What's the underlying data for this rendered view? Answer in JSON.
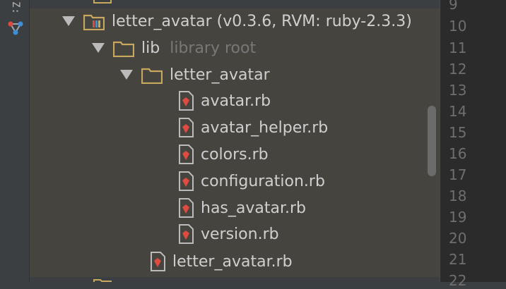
{
  "sidebar": {
    "tool_label": "Z:"
  },
  "project": {
    "root": {
      "name": "letter_avatar (v0.3.6, RVM: ruby-2.3.3)"
    },
    "lib": {
      "name": "lib",
      "hint": "library root"
    },
    "subfolder": {
      "name": "letter_avatar"
    },
    "files": [
      "avatar.rb",
      "avatar_helper.rb",
      "colors.rb",
      "configuration.rb",
      "has_avatar.rb",
      "version.rb"
    ],
    "lib_file": "letter_avatar.rb"
  },
  "gutter": {
    "lines": [
      "9",
      "10",
      "11",
      "12",
      "13",
      "14",
      "15",
      "16",
      "17",
      "18",
      "19",
      "20",
      "21",
      "22"
    ]
  },
  "colors": {
    "folder": "#c8a75f",
    "ruby": "#e04b41",
    "selection": "#46443f"
  }
}
